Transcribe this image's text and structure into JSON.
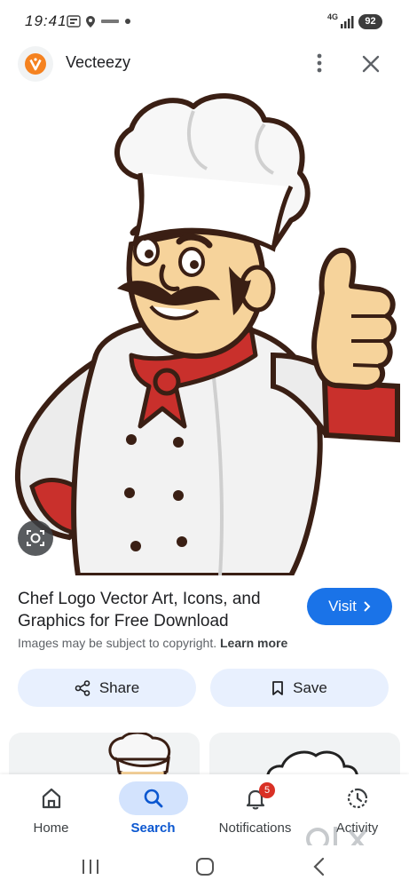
{
  "status_bar": {
    "time": "19:41",
    "network": "4G",
    "battery": "92"
  },
  "header": {
    "site_title": "Vecteezy",
    "logo_icon": "vecteezy-logo-icon",
    "menu_icon": "more-vert-icon",
    "close_icon": "close-icon"
  },
  "result": {
    "title": "Chef Logo Vector Art, Icons, and Graphics for Free Download",
    "visit_label": "Visit",
    "copyright_text": "Images may be subject to copyright.",
    "learn_more": "Learn more",
    "share_label": "Share",
    "save_label": "Save"
  },
  "bottom_nav": {
    "items": [
      {
        "label": "Home",
        "icon": "home-icon"
      },
      {
        "label": "Search",
        "icon": "search-icon"
      },
      {
        "label": "Notifications",
        "icon": "bell-icon",
        "badge": "5"
      },
      {
        "label": "Activity",
        "icon": "activity-icon"
      }
    ]
  },
  "colors": {
    "accent": "#1a73e8",
    "pill": "#d3e3fd",
    "button_bg": "#e8f0fe",
    "badge": "#d93025",
    "chef_red": "#c9302c",
    "chef_skin": "#f6d39b"
  }
}
